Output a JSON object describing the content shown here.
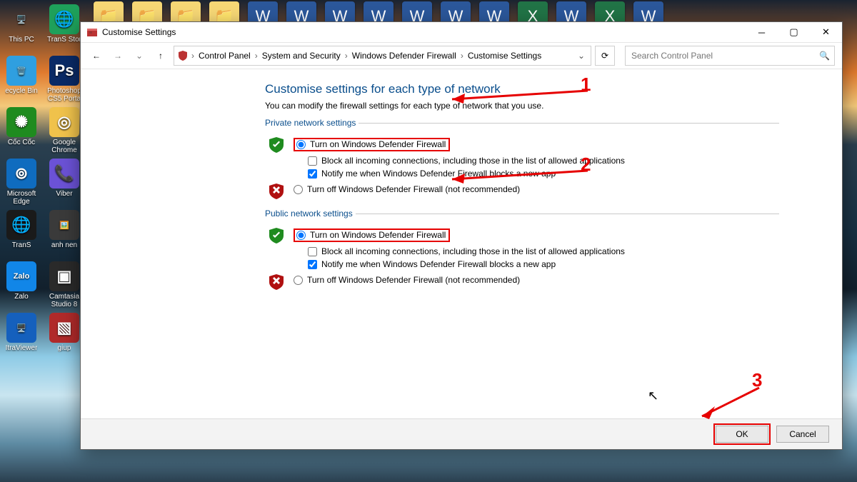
{
  "desktop": {
    "left_icons": [
      {
        "label": "This PC",
        "emoji": "🖥️",
        "bg": "transparent"
      },
      {
        "label": "TranS Stor",
        "emoji": "🌐",
        "bg": "#1ea05a"
      },
      {
        "label": "ecycle Bin",
        "emoji": "🗑️",
        "bg": "#2f9fe0"
      },
      {
        "label": "Photoshop CS5 Porta",
        "emoji": "Ps",
        "bg": "#0a2a66"
      },
      {
        "label": "Cốc Cốc",
        "emoji": "✺",
        "bg": "#1f8b1f"
      },
      {
        "label": "Google Chrome",
        "emoji": "◎",
        "bg": "#f0c24b"
      },
      {
        "label": "Microsoft Edge",
        "emoji": "⊚",
        "bg": "#0f6cbf"
      },
      {
        "label": "Viber",
        "emoji": "📞",
        "bg": "#6b52d6"
      },
      {
        "label": "TranS",
        "emoji": "🌐",
        "bg": "#1a1a1a"
      },
      {
        "label": "anh nen",
        "emoji": "🖼️",
        "bg": "#3a3a3a"
      },
      {
        "label": "Zalo",
        "emoji": "Zalo",
        "bg": "#1186e8"
      },
      {
        "label": "Camtasia Studio 8",
        "emoji": "▣",
        "bg": "#2a2a2a"
      },
      {
        "label": "ItraViewer",
        "emoji": "🖥️",
        "bg": "#1560bd"
      },
      {
        "label": "giup",
        "emoji": "▧",
        "bg": "#b02a2a"
      }
    ],
    "taskbar_icons": [
      "folder",
      "folder",
      "folder",
      "folder",
      "word",
      "word",
      "word",
      "word",
      "word",
      "word",
      "word",
      "excel",
      "word",
      "excel",
      "word"
    ]
  },
  "window": {
    "title": "Customise Settings",
    "breadcrumb": [
      "Control Panel",
      "System and Security",
      "Windows Defender Firewall",
      "Customise Settings"
    ],
    "search_placeholder": "Search Control Panel",
    "heading": "Customise settings for each type of network",
    "subtitle": "You can modify the firewall settings for each type of network that you use.",
    "private": {
      "legend": "Private network settings",
      "turn_on": "Turn on Windows Defender Firewall",
      "block": "Block all incoming connections, including those in the list of allowed applications",
      "notify": "Notify me when Windows Defender Firewall blocks a new app",
      "turn_off": "Turn off Windows Defender Firewall (not recommended)"
    },
    "public": {
      "legend": "Public network settings",
      "turn_on": "Turn on Windows Defender Firewall",
      "block": "Block all incoming connections, including those in the list of allowed applications",
      "notify": "Notify me when Windows Defender Firewall blocks a new app",
      "turn_off": "Turn off Windows Defender Firewall (not recommended)"
    },
    "ok": "OK",
    "cancel": "Cancel"
  },
  "annotations": {
    "n1": "1",
    "n2": "2",
    "n3": "3"
  },
  "colors": {
    "accent": "#0a4e8c",
    "danger": "#e60000"
  }
}
